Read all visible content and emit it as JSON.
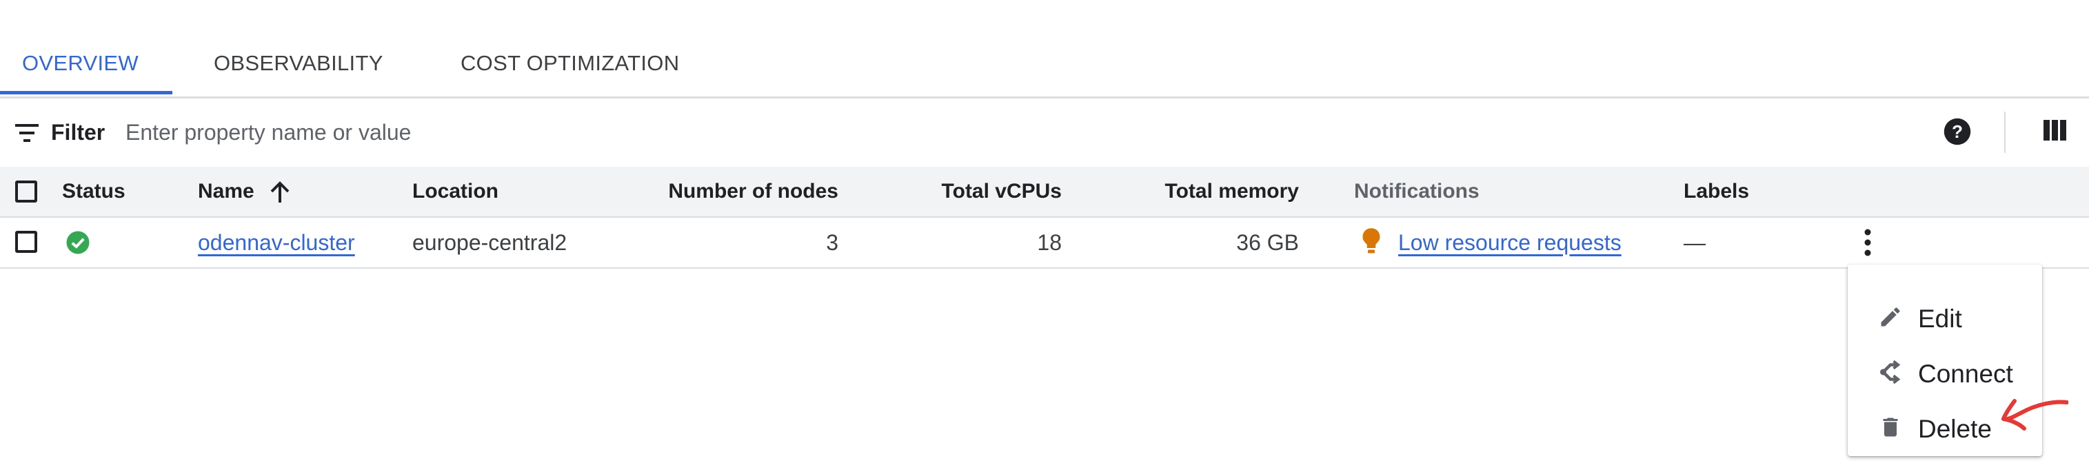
{
  "tabs": [
    {
      "label": "OVERVIEW",
      "active": true
    },
    {
      "label": "OBSERVABILITY",
      "active": false
    },
    {
      "label": "COST OPTIMIZATION",
      "active": false
    }
  ],
  "filter": {
    "label": "Filter",
    "placeholder": "Enter property name or value",
    "value": ""
  },
  "table": {
    "headers": {
      "status": "Status",
      "name": "Name",
      "location": "Location",
      "nodes": "Number of nodes",
      "vcpus": "Total vCPUs",
      "memory": "Total memory",
      "notifications": "Notifications",
      "labels": "Labels"
    },
    "rows": [
      {
        "status": "ok",
        "name": "odennav-cluster",
        "location": "europe-central2",
        "nodes": "3",
        "vcpus": "18",
        "memory": "36 GB",
        "notification": "Low resource requests",
        "labels": "—"
      }
    ]
  },
  "menu": {
    "items": [
      {
        "label": "Edit",
        "icon": "pencil-icon"
      },
      {
        "label": "Connect",
        "icon": "connect-icon"
      },
      {
        "label": "Delete",
        "icon": "trash-icon"
      }
    ]
  },
  "colors": {
    "accent": "#3367d6",
    "status_ok": "#34a853",
    "notification": "#d97706",
    "annotation": "#e53935"
  }
}
